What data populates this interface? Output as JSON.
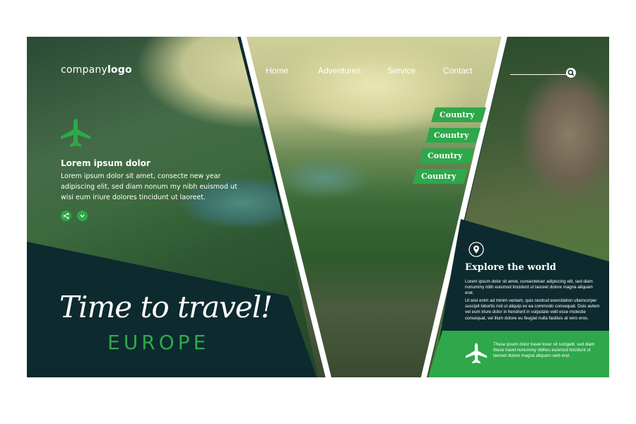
{
  "brand": {
    "logo_regular": "company",
    "logo_bold": "logo"
  },
  "nav": {
    "items": [
      "Home",
      "Adventures",
      "Service",
      "Contact"
    ]
  },
  "search": {
    "icon": "search-icon"
  },
  "hero": {
    "icon": "airplane-icon",
    "title": "Lorem ipsum dolor",
    "body": "Lorem ipsum dolor sit amet, consecte new year adipiscing elit, sed diam nonum my nibh euismod ut wisi eum iriure dolores tincidunt ut laoreet.",
    "buttons": [
      "share-icon",
      "chevron-down-icon"
    ]
  },
  "headline": {
    "script": "Time to travel!",
    "destination": "EUROPE"
  },
  "countries": [
    "Country",
    "Country",
    "Country",
    "Country"
  ],
  "info": {
    "icon": "map-pin-icon",
    "title": "Explore the world",
    "paragraph1": "Lorem ipsum dolor sit amet, consectetuer adipiscing elit, sed diam nonummy nibh euismod tincidunt ut laoreet dolore magna aliquam erat.",
    "paragraph2": "Ut wisi enim ad minim veniam, quis nostrud exercitation ullamcorper suscipit lobortis nisl ut aliquip ex ea commodo consequat. Duis autem vel eum iriure dolor in hendrerit in vulputate velit esse molestie consequat, vel illum dolore eu feugiat nulla facilisis at vero eros.",
    "footer_icon": "airplane-icon",
    "footer_text": "These ipsum dolor travel lover sit  scingelit, sed diam these travel nonummy nibhes euismod tincidunt ut laoreet dolore magna aliquam web erat."
  },
  "colors": {
    "accent_green": "#2ea84a",
    "dark_teal": "#0d2a2e",
    "text": "#ffffff"
  }
}
